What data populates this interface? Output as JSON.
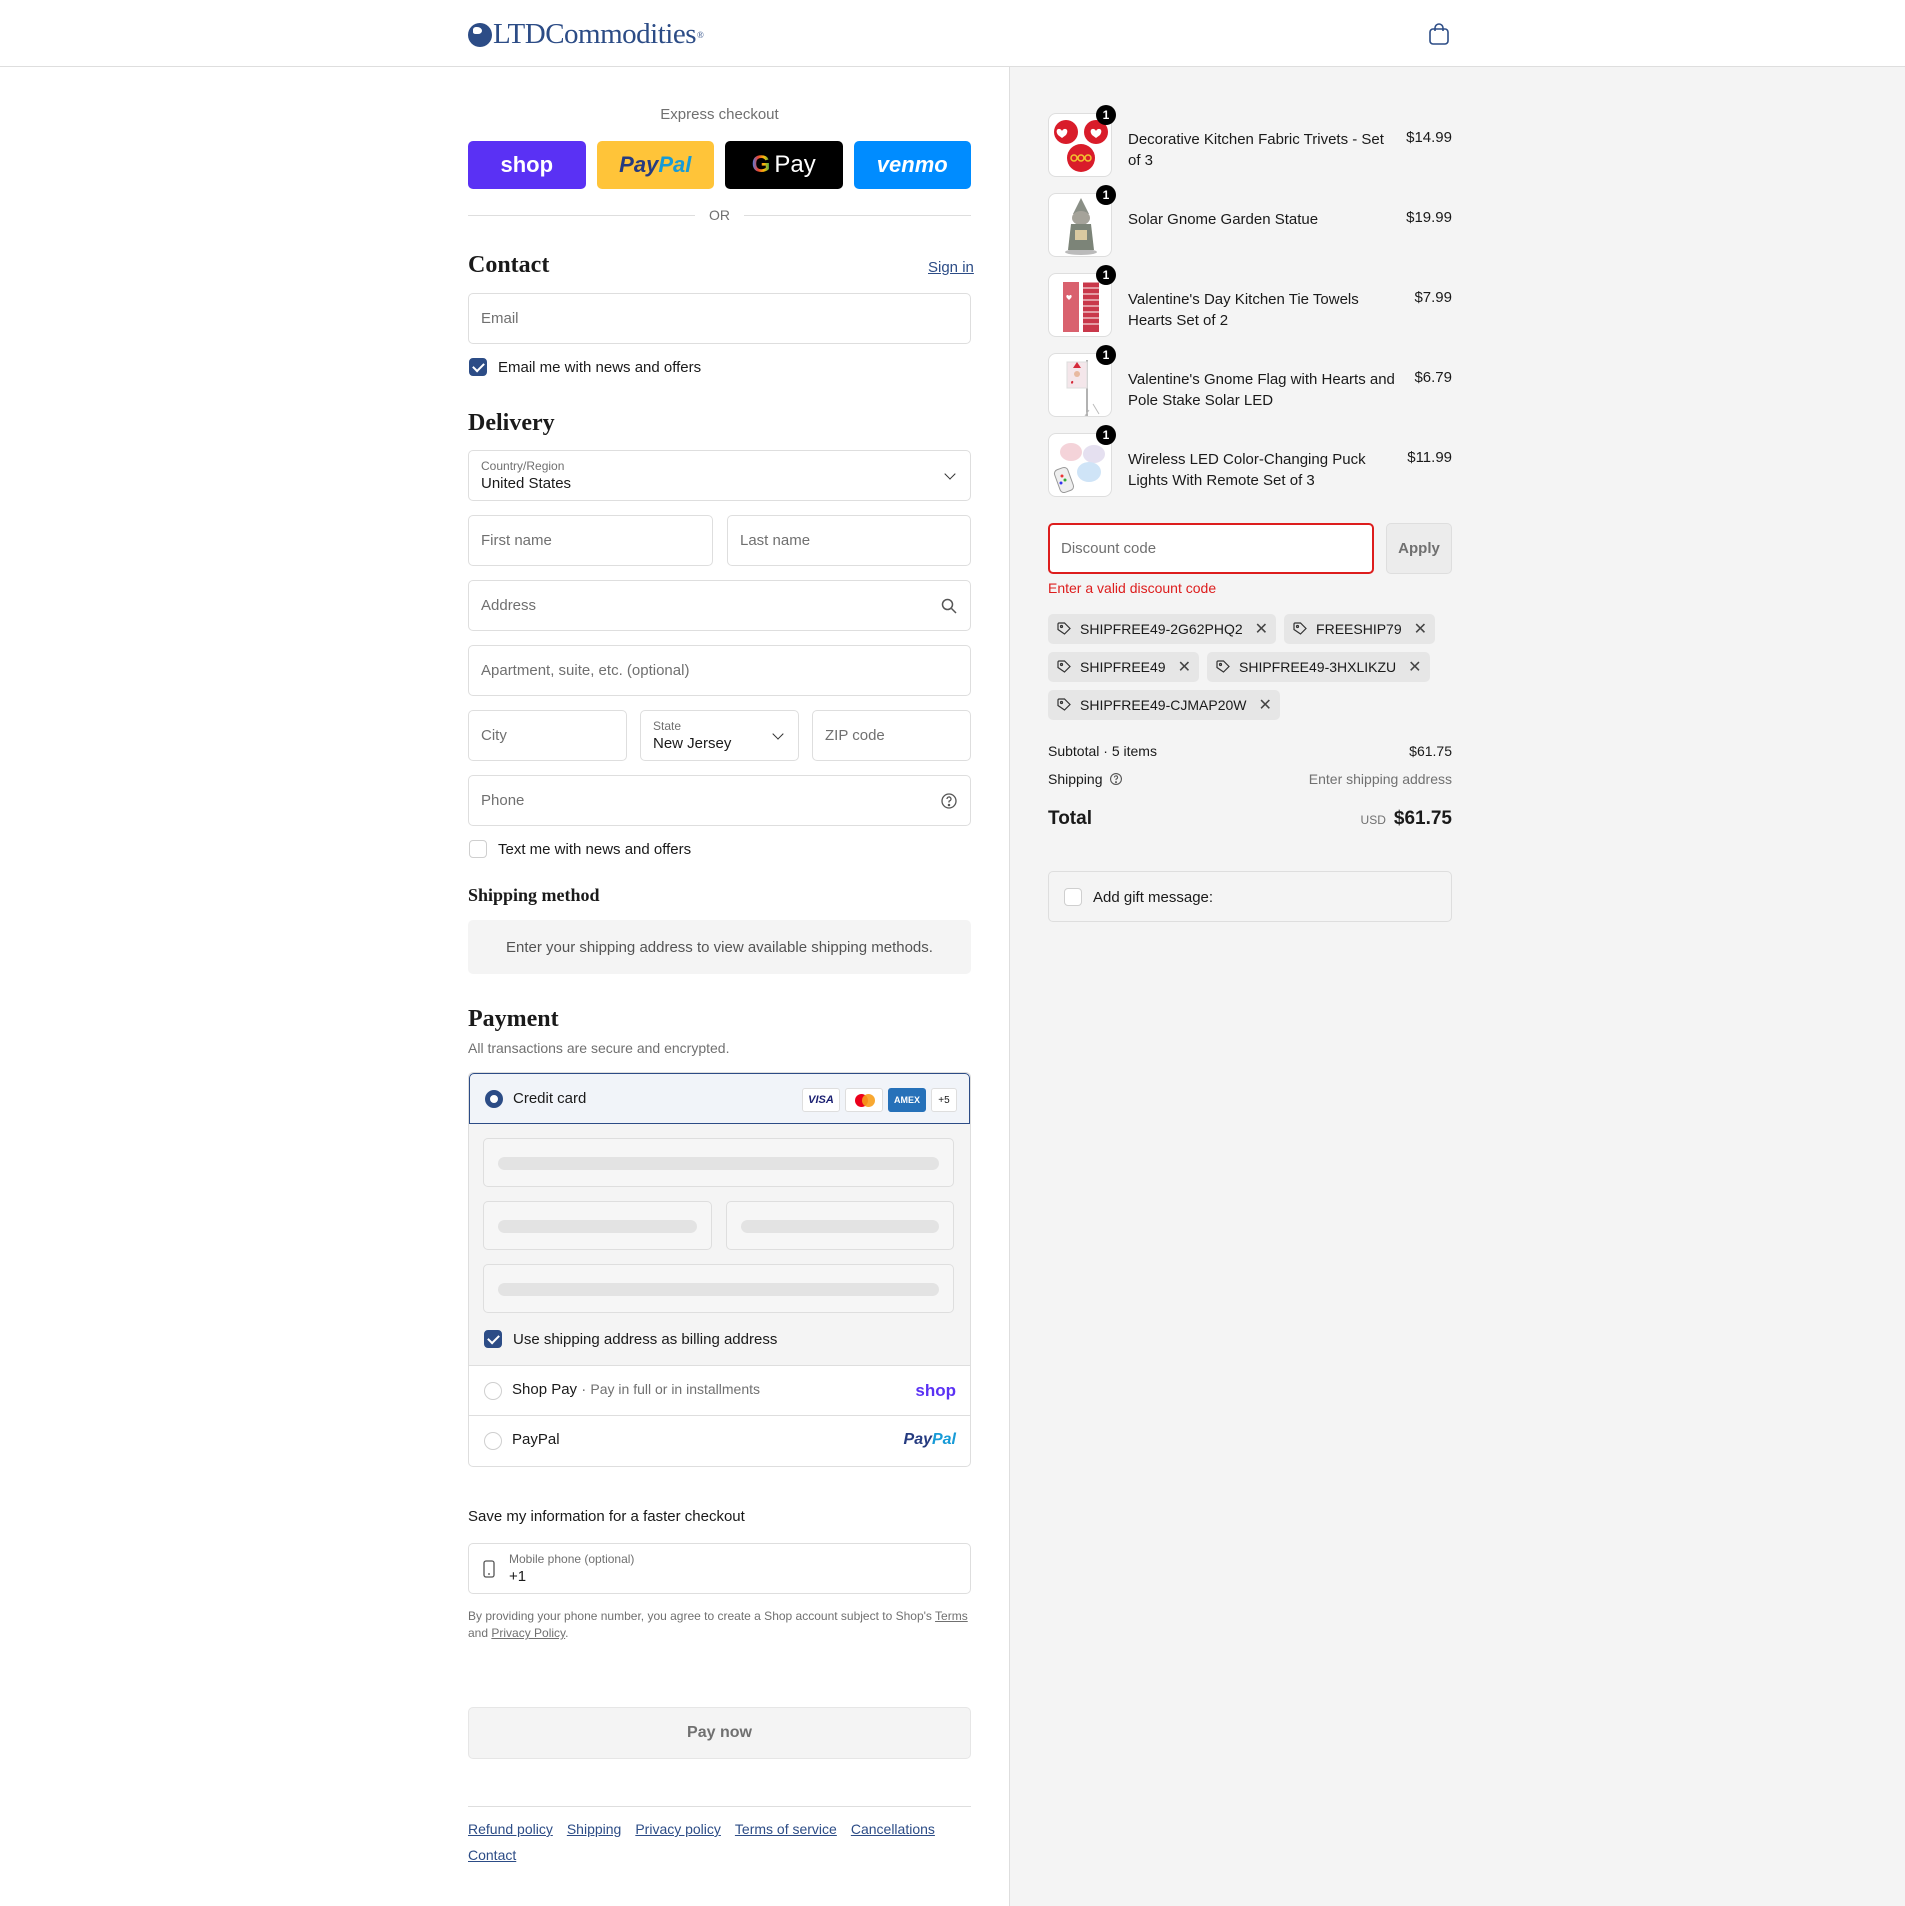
{
  "header": {
    "brand": "LTDCommodities",
    "brand_mark": "®"
  },
  "express": {
    "title": "Express checkout",
    "buttons": {
      "shop": "shop",
      "paypal_a": "Pay",
      "paypal_b": "Pal",
      "gpay_g": "G",
      "gpay": "Pay",
      "venmo": "venmo"
    },
    "or": "OR"
  },
  "contact": {
    "title": "Contact",
    "sign_in": "Sign in",
    "email_placeholder": "Email",
    "email_news": "Email me with news and offers",
    "email_news_checked": true
  },
  "delivery": {
    "title": "Delivery",
    "country_label": "Country/Region",
    "country_value": "United States",
    "first_name": "First name",
    "last_name": "Last name",
    "address": "Address",
    "apartment": "Apartment, suite, etc. (optional)",
    "city": "City",
    "state_label": "State",
    "state_value": "New Jersey",
    "zip": "ZIP code",
    "phone": "Phone",
    "text_news": "Text me with news and offers",
    "text_news_checked": false
  },
  "shipping_method": {
    "title": "Shipping method",
    "notice": "Enter your shipping address to view available shipping methods."
  },
  "payment": {
    "title": "Payment",
    "subtitle": "All transactions are secure and encrypted.",
    "credit_card": "Credit card",
    "cards": {
      "visa": "VISA",
      "amex": "AMEX",
      "more": "+5"
    },
    "billing_same": "Use shipping address as billing address",
    "billing_same_checked": true,
    "shop_pay": "Shop Pay",
    "shop_pay_sep": "·",
    "shop_pay_sub": "Pay in full or in installments",
    "shop_logo": "shop",
    "paypal": "PayPal",
    "paypal_logo_a": "Pay",
    "paypal_logo_b": "Pal"
  },
  "save_info": {
    "title": "Save my information for a faster checkout",
    "mobile_label": "Mobile phone (optional)",
    "mobile_value": "+1",
    "disclaimer_a": "By providing your phone number, you agree to create a Shop account subject to Shop's ",
    "terms": "Terms",
    "disclaimer_b": "and ",
    "privacy": "Privacy Policy",
    "disclaimer_c": "."
  },
  "pay_now": "Pay now",
  "footer_links": [
    "Refund policy",
    "Shipping",
    "Privacy policy",
    "Terms of service",
    "Cancellations",
    "Contact"
  ],
  "cart": {
    "items": [
      {
        "name": "Decorative Kitchen Fabric Trivets - Set of 3",
        "price": "$14.99",
        "qty": "1"
      },
      {
        "name": "Solar Gnome Garden Statue",
        "price": "$19.99",
        "qty": "1"
      },
      {
        "name": "Valentine's Day Kitchen Tie Towels Hearts Set of 2",
        "price": "$7.99",
        "qty": "1"
      },
      {
        "name": "Valentine's Gnome Flag with Hearts and Pole Stake Solar LED",
        "price": "$6.79",
        "qty": "1"
      },
      {
        "name": "Wireless LED Color-Changing Puck Lights With Remote Set of 3",
        "price": "$11.99",
        "qty": "1"
      }
    ],
    "discount_placeholder": "Discount code",
    "apply": "Apply",
    "error": "Enter a valid discount code",
    "codes": [
      "SHIPFREE49-2G62PHQ2",
      "FREESHIP79",
      "SHIPFREE49",
      "SHIPFREE49-3HXLIKZU",
      "SHIPFREE49-CJMAP20W"
    ],
    "subtotal_label": "Subtotal · 5 items",
    "subtotal": "$61.75",
    "shipping_label": "Shipping",
    "shipping_value": "Enter shipping address",
    "total_label": "Total",
    "currency": "USD",
    "total": "$61.75",
    "gift": "Add gift message:"
  },
  "colors": {
    "accent": "#2c4c86",
    "error": "#dd1d1d",
    "shop": "#5a31f4",
    "panel": "#f4f4f4"
  }
}
